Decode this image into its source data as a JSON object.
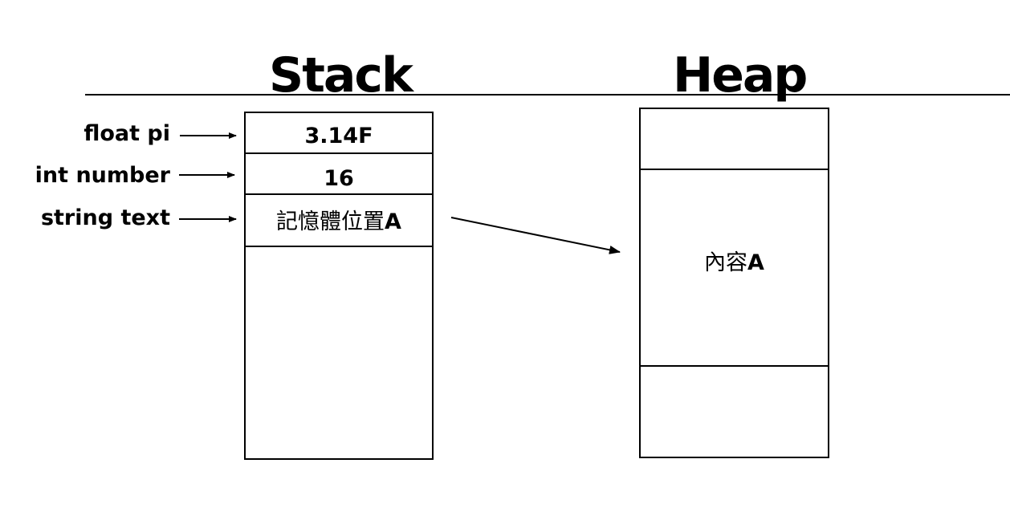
{
  "stack": {
    "title": "Stack",
    "cells": [
      {
        "variable": "float pi",
        "value": "3.14F"
      },
      {
        "variable": "int number",
        "value": "16"
      },
      {
        "variable": "string text",
        "value_cjk": "記憶體位置",
        "value_suffix": "A"
      }
    ]
  },
  "heap": {
    "title": "Heap",
    "content_cjk": "內容",
    "content_suffix": "A"
  }
}
